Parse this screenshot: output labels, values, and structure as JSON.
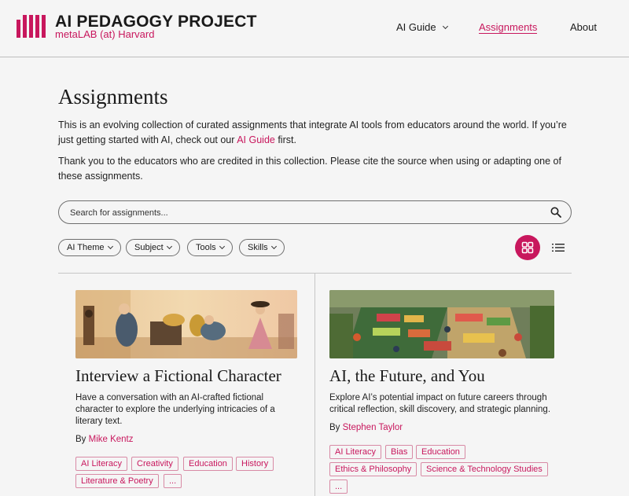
{
  "header": {
    "logo_title": "AI PEDAGOGY PROJECT",
    "logo_subtitle": "metaLAB (at) Harvard",
    "nav": {
      "ai_guide": "AI Guide",
      "assignments": "Assignments",
      "about": "About"
    }
  },
  "main": {
    "title": "Assignments",
    "intro1_prefix": "This is an evolving collection of curated assignments that integrate AI tools from educators around the world. If you’re just getting started with AI, check out our ",
    "intro1_link": "AI Guide",
    "intro1_suffix": " first.",
    "intro2": "Thank you to the educators who are credited in this collection. Please cite the source when using or adapting one of these assignments.",
    "search": {
      "placeholder": "Search for assignments..."
    },
    "filters": [
      "AI Theme",
      "Subject",
      "Tools",
      "Skills"
    ],
    "view_mode": "grid"
  },
  "cards": [
    {
      "title": "Interview a Fictional Character",
      "description": "Have a conversation with an AI-crafted fictional character to explore the underlying intricacies of a literary text.",
      "by_prefix": "By ",
      "author": "Mike Kentz",
      "tags": [
        "AI Literacy",
        "Creativity",
        "Education",
        "History",
        "Literature & Poetry",
        "..."
      ]
    },
    {
      "title": "AI, the Future, and You",
      "description": "Explore AI’s potential impact on future careers through critical reflection, skill discovery, and strategic planning.",
      "by_prefix": "By ",
      "author": "Stephen Taylor",
      "tags": [
        "AI Literacy",
        "Bias",
        "Education",
        "Ethics & Philosophy",
        "Science & Technology Studies",
        "..."
      ]
    }
  ],
  "colors": {
    "accent": "#c8175d",
    "background": "#f5f5f5"
  },
  "icons": {
    "search": "search-icon",
    "grid": "grid-view-icon",
    "list": "list-view-icon",
    "chevron": "chevron-down-icon"
  }
}
